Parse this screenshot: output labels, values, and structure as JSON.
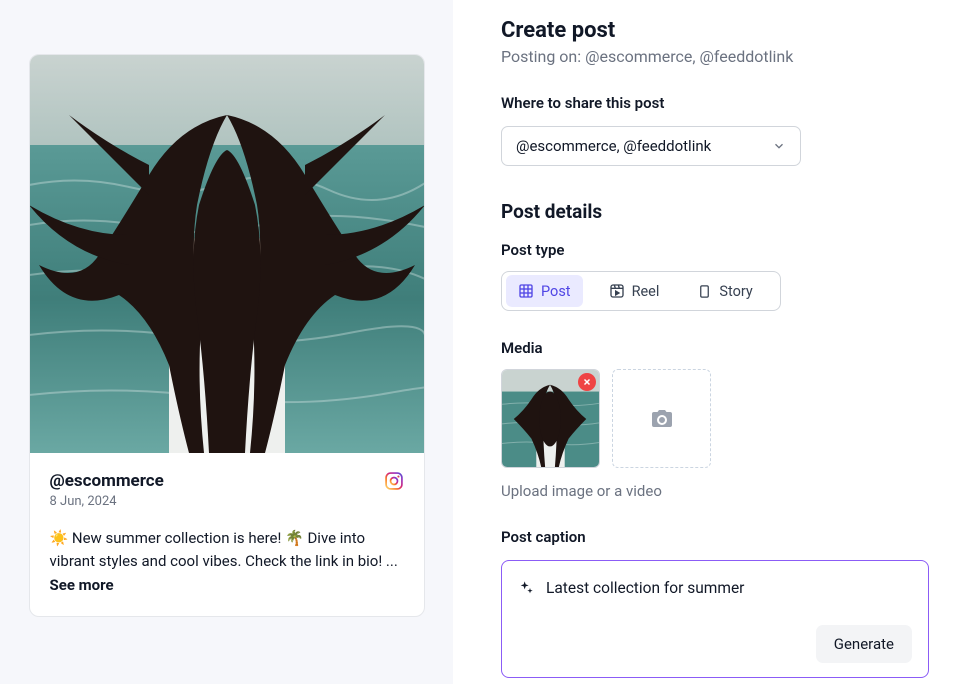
{
  "preview": {
    "handle": "@escommerce",
    "date": "8 Jun, 2024",
    "caption": "☀️ New summer collection is here! 🌴 Dive into vibrant styles and cool vibes. Check the link in bio! ...",
    "see_more": "See more"
  },
  "form": {
    "title": "Create post",
    "subtitle": "Posting on: @escommerce, @feeddotlink",
    "share_label": "Where to share this post",
    "share_value": "@escommerce, @feeddotlink",
    "details_title": "Post details",
    "post_type_label": "Post type",
    "types": {
      "post": "Post",
      "reel": "Reel",
      "story": "Story"
    },
    "media_label": "Media",
    "media_helper": "Upload image or a video",
    "caption_label": "Post caption",
    "caption_value": "Latest collection for summer",
    "generate_label": "Generate"
  },
  "icons": {
    "remove": "close-icon",
    "camera": "camera-icon",
    "sparkle": "sparkle-icon",
    "instagram": "instagram-icon"
  }
}
